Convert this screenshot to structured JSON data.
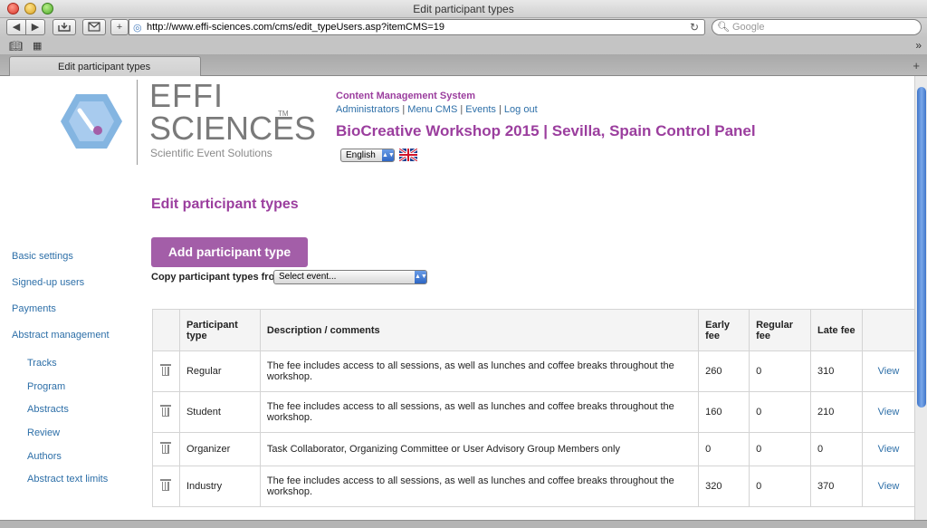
{
  "window": {
    "title": "Edit participant types"
  },
  "browser": {
    "url": "http://www.effi-sciences.com/cms/edit_typeUsers.asp?itemCMS=19",
    "search_placeholder": "Google",
    "tab_label": "Edit participant types"
  },
  "logo": {
    "line1": "EFFI",
    "line2": "SCIENCES",
    "tm": "TM",
    "tagline": "Scientific Event Solutions",
    "accent_color": "#6fa8dc"
  },
  "header": {
    "cms_label": "Content Management System",
    "links": [
      "Administrators",
      "Menu CMS",
      "Events",
      "Log out"
    ],
    "link_separator": "|",
    "event_title": "BioCreative Workshop 2015 | Sevilla, Spain Control Panel",
    "language": "English"
  },
  "page": {
    "heading": "Edit participant types",
    "add_button": "Add participant type",
    "copy_label": "Copy participant types from:",
    "copy_select": "Select event..."
  },
  "sidebar": {
    "items": [
      "Basic settings",
      "Signed-up users",
      "Payments",
      "Abstract management"
    ],
    "subitems": [
      "Tracks",
      "Program",
      "Abstracts",
      "Review",
      "Authors",
      "Abstract text limits"
    ]
  },
  "table": {
    "headers": [
      "Participant type",
      "Description / comments",
      "Early fee",
      "Regular fee",
      "Late fee"
    ],
    "rows": [
      {
        "type": "Regular",
        "description": "The fee includes access to all sessions, as well as lunches and coffee breaks throughout the workshop.",
        "early": "260",
        "regular": "0",
        "late": "310",
        "action": "View"
      },
      {
        "type": "Student",
        "description": "The fee includes access to all sessions, as well as lunches and coffee breaks throughout the workshop.",
        "early": "160",
        "regular": "0",
        "late": "210",
        "action": "View"
      },
      {
        "type": "Organizer",
        "description": "Task Collaborator, Organizing Committee or User Advisory Group Members only",
        "early": "0",
        "regular": "0",
        "late": "0",
        "action": "View"
      },
      {
        "type": "Industry",
        "description": "The fee includes access to all sessions, as well as lunches and coffee breaks throughout the workshop.",
        "early": "320",
        "regular": "0",
        "late": "370",
        "action": "View"
      }
    ]
  },
  "colors": {
    "brand_purple": "#9b3e9e",
    "button_purple": "#a35ea8",
    "link_blue": "#2d6fa8"
  }
}
